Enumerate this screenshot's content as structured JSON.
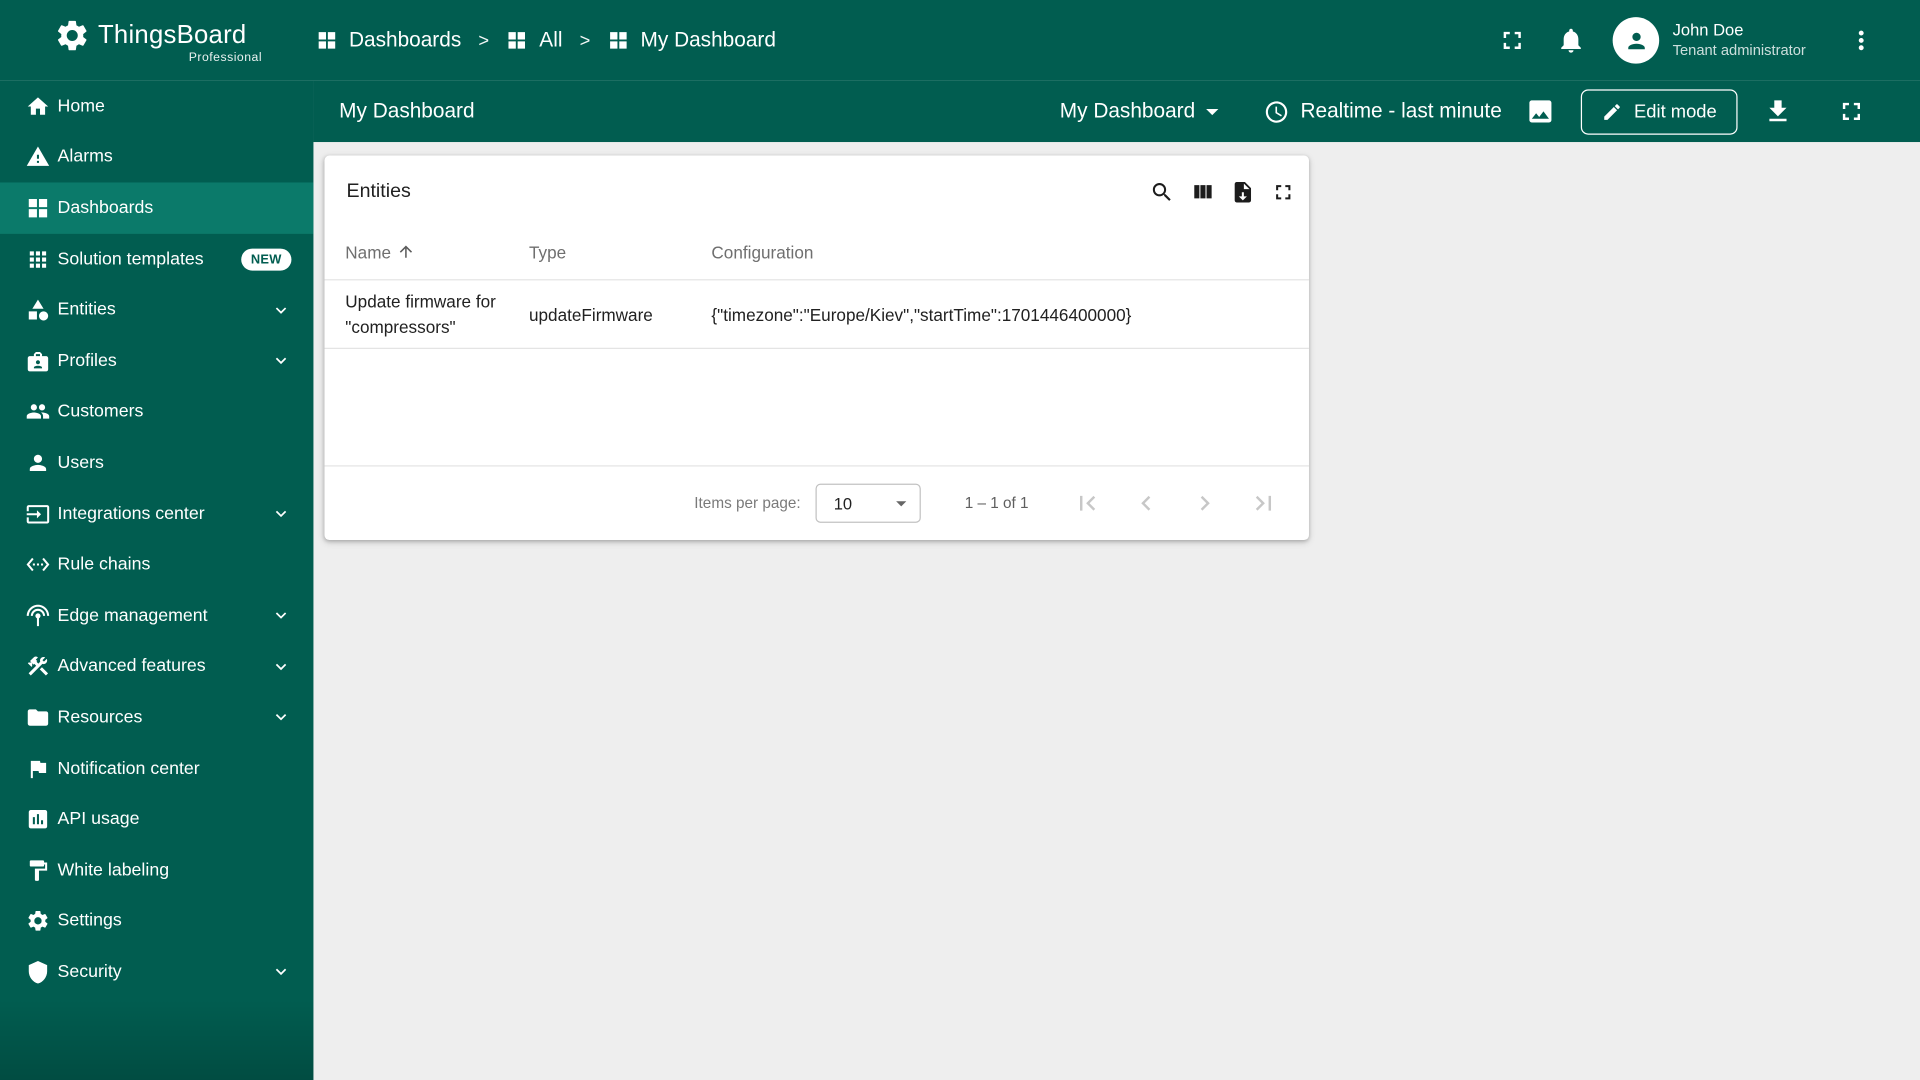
{
  "app": {
    "name": "ThingsBoard",
    "edition": "Professional"
  },
  "header": {
    "breadcrumbs": [
      {
        "label": "Dashboards",
        "icon": "dashboards-icon"
      },
      {
        "label": "All",
        "icon": "dashboards-icon"
      },
      {
        "label": "My Dashboard",
        "icon": "dashboards-icon"
      }
    ],
    "separator": ">",
    "user": {
      "name": "John Doe",
      "role": "Tenant administrator"
    }
  },
  "toolbar": {
    "title": "My Dashboard",
    "state_selector": "My Dashboard",
    "timewindow": "Realtime - last minute",
    "edit_button": "Edit mode"
  },
  "sidebar": {
    "items": [
      {
        "label": "Home",
        "icon": "home-icon"
      },
      {
        "label": "Alarms",
        "icon": "alarms-icon"
      },
      {
        "label": "Dashboards",
        "icon": "dashboards-icon",
        "active": true
      },
      {
        "label": "Solution templates",
        "icon": "solution-templates-icon",
        "badge": "NEW"
      },
      {
        "label": "Entities",
        "icon": "entities-icon",
        "expandable": true
      },
      {
        "label": "Profiles",
        "icon": "profiles-icon",
        "expandable": true
      },
      {
        "label": "Customers",
        "icon": "customers-icon"
      },
      {
        "label": "Users",
        "icon": "users-icon"
      },
      {
        "label": "Integrations center",
        "icon": "integrations-center-icon",
        "expandable": true
      },
      {
        "label": "Rule chains",
        "icon": "rule-chains-icon"
      },
      {
        "label": "Edge management",
        "icon": "edge-management-icon",
        "expandable": true
      },
      {
        "label": "Advanced features",
        "icon": "advanced-features-icon",
        "expandable": true
      },
      {
        "label": "Resources",
        "icon": "resources-icon",
        "expandable": true
      },
      {
        "label": "Notification center",
        "icon": "notification-center-icon"
      },
      {
        "label": "API usage",
        "icon": "api-usage-icon"
      },
      {
        "label": "White labeling",
        "icon": "white-labeling-icon"
      },
      {
        "label": "Settings",
        "icon": "settings-icon"
      },
      {
        "label": "Security",
        "icon": "security-icon",
        "expandable": true
      }
    ]
  },
  "widget": {
    "title": "Entities",
    "table": {
      "columns": [
        "Name",
        "Type",
        "Configuration"
      ],
      "rows": [
        {
          "name": "Update firmware for \"compressors\"",
          "type": "updateFirmware",
          "configuration": "{\"timezone\":\"Europe/Kiev\",\"startTime\":1701446400000}"
        }
      ]
    },
    "footer": {
      "items_per_page_label": "Items per page:",
      "items_per_page": "10",
      "range": "1 – 1 of 1"
    }
  },
  "colors": {
    "primary": "#015d50",
    "primary_active": "#0b7a6a",
    "content_bg": "#eeeeee"
  }
}
